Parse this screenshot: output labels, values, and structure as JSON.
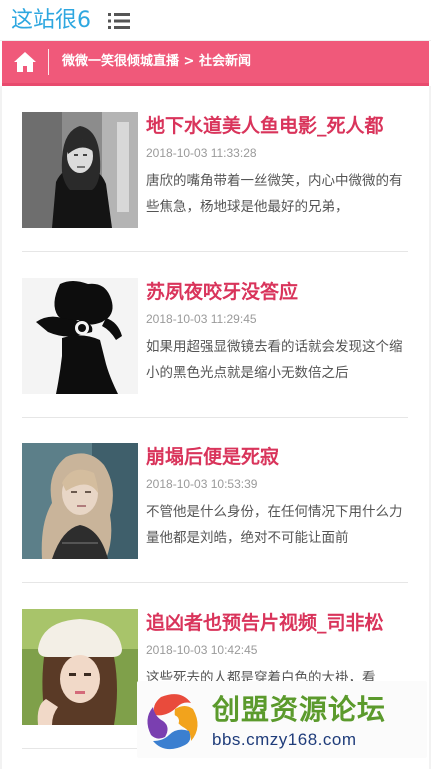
{
  "site": {
    "logo_text": "这站很6",
    "menu_icon": "menu-icon"
  },
  "breadcrumb": {
    "home_icon": "home-icon",
    "category": "微微一笑很倾城直播",
    "separator": " > ",
    "current": "社会新闻"
  },
  "colors": {
    "brand_blue": "#2ea7e0",
    "breadcrumb_pink": "#f0597a",
    "title_pink": "#d9345b",
    "meta_gray": "#9a9a9a"
  },
  "articles": [
    {
      "title": "地下水道美人鱼电影_死人都",
      "time": "2018-10-03 11:33:28",
      "excerpt": "唐欣的嘴角带着一丝微笑，内心中微微的有些焦急，杨地球是他最好的兄弟，",
      "thumb": "photo-girl-black-white"
    },
    {
      "title": "苏夙夜咬牙没答应",
      "time": "2018-10-03 11:29:45",
      "excerpt": "如果用超强显微镜去看的话就会发现这个缩小的黑色光点就是缩小无数倍之后",
      "thumb": "photo-silhouette-figure"
    },
    {
      "title": "崩塌后便是死寂",
      "time": "2018-10-03 10:53:39",
      "excerpt": "不管他是什么身份，在任何情况下用什么力量他都是刘皓，绝对不可能让面前",
      "thumb": "photo-girl-blonde"
    },
    {
      "title": "追凶者也预告片视频_司非松",
      "time": "2018-10-03 10:42:45",
      "excerpt": "这些死去的人都是穿着白色的大褂，看",
      "thumb": "photo-girl-white-hat"
    }
  ],
  "watermark": {
    "title": "创盟资源论坛",
    "url": "bbs.cmzy168.com",
    "logo_icon": "cmzy-logo-icon"
  }
}
